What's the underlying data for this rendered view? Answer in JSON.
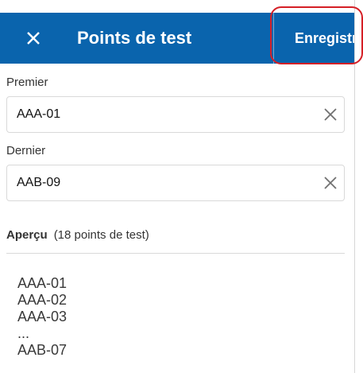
{
  "header": {
    "title": "Points de test",
    "close_icon": "close-icon",
    "save_label": "Enregistrer"
  },
  "fields": {
    "first": {
      "label": "Premier",
      "value": "AAA-01",
      "clear_icon": "clear-icon"
    },
    "last": {
      "label": "Dernier",
      "value": "AAB-09",
      "clear_icon": "clear-icon"
    }
  },
  "preview": {
    "title": "Aperçu",
    "count": "(18 points de test)",
    "items": [
      "AAA-01",
      "AAA-02",
      "AAA-03",
      "...",
      "AAB-07"
    ]
  },
  "colors": {
    "header_bg": "#0a64ad",
    "highlight": "#d51f26"
  }
}
